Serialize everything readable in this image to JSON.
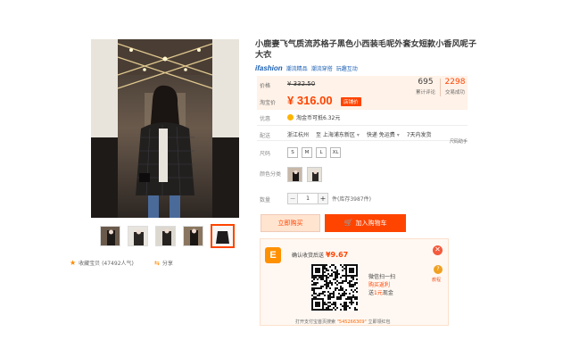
{
  "product": {
    "title": "小鹿妻飞气质流苏格子黑色小西装毛呢外套女短款小香风呢子大衣",
    "brand_logo": "ifashion",
    "brand_tags": [
      "潮流精品",
      "潮流穿搭",
      "玩趣互动"
    ]
  },
  "price": {
    "original_label": "价格",
    "original_value": "¥ 332.50",
    "current_label": "淘宝价",
    "current_value": "¥ 316.00",
    "promo_badge": "店铺价",
    "stats": [
      {
        "value": "695",
        "label": "累计评论"
      },
      {
        "value": "2298",
        "label": "交易成功"
      }
    ]
  },
  "benefit": {
    "label": "优惠",
    "text": "淘金币可抵6.32元"
  },
  "delivery": {
    "label": "配送",
    "from": "浙江杭州",
    "to": "至 上海浦东新区",
    "fee": "快递 免运费",
    "returns": "7天内发货"
  },
  "size": {
    "label": "尺码",
    "chart_link": "尺码助手",
    "options": [
      "S",
      "M",
      "L",
      "XL"
    ]
  },
  "color": {
    "label": "颜色分类"
  },
  "quantity": {
    "label": "数量",
    "value": "1",
    "minus": "−",
    "plus": "+",
    "stock": "件(库存3987件)"
  },
  "actions": {
    "buy_now": "立即购买",
    "add_cart": "加入购物车"
  },
  "gallery": {
    "favorite": "收藏宝贝 (47492人气)",
    "share": "分享"
  },
  "promo": {
    "logo": "E",
    "confirm_text": "确认收货后送",
    "amount": "¥9.67",
    "scan_line1": "微信扫一扫",
    "scan_line2": "购买返利",
    "scan_line3_pre": "送",
    "scan_line3_amt": "1元",
    "scan_line3_post": "现金",
    "help_label": "教程",
    "bottom_pre": "打开支付宝首页搜索",
    "bottom_code": "\"545266309\"",
    "bottom_post": "立即领红包"
  },
  "colors": {
    "accent": "#ff4400",
    "price_bg": "#fff2e8"
  }
}
